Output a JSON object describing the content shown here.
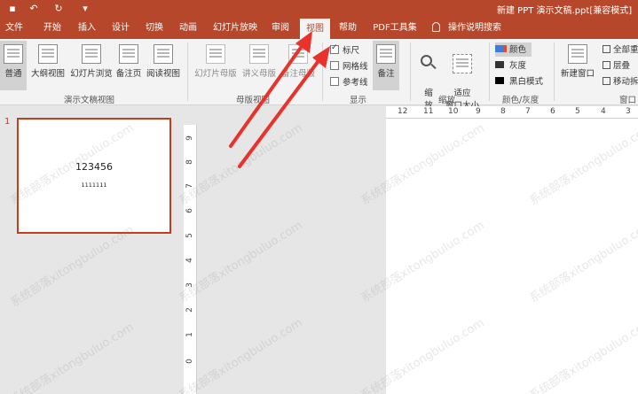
{
  "window": {
    "title": "新建 PPT 演示文稿.ppt[兼容模式]"
  },
  "quick_access": [
    {
      "icon": "save-icon"
    },
    {
      "icon": "undo-icon"
    },
    {
      "icon": "redo-icon"
    },
    {
      "icon": "customize-icon"
    }
  ],
  "tabs": [
    {
      "label": "文件"
    },
    {
      "label": "开始"
    },
    {
      "label": "插入"
    },
    {
      "label": "设计"
    },
    {
      "label": "切换"
    },
    {
      "label": "动画"
    },
    {
      "label": "幻灯片放映"
    },
    {
      "label": "审阅"
    },
    {
      "label": "视图",
      "active": true
    },
    {
      "label": "帮助"
    },
    {
      "label": "PDF工具集"
    }
  ],
  "tell_me": "操作说明搜索",
  "ribbon": {
    "presentation_views": {
      "label": "演示文稿视图",
      "buttons": [
        "普通",
        "大纲视图",
        "幻灯片浏览",
        "备注页",
        "阅读视图"
      ]
    },
    "master_views": {
      "label": "母版视图",
      "buttons": [
        "幻灯片母版",
        "讲义母版",
        "备注母版"
      ]
    },
    "show": {
      "label": "显示",
      "checkboxes": [
        {
          "label": "标尺",
          "checked": true
        },
        {
          "label": "网格线",
          "checked": false
        },
        {
          "label": "参考线",
          "checked": false
        }
      ],
      "notes_button": "备注"
    },
    "zoom": {
      "label": "缩放",
      "zoom_button": "缩\n放",
      "fit_button": "适应\n窗口大小"
    },
    "color_grayscale": {
      "label": "颜色/灰度",
      "items": [
        {
          "label": "颜色",
          "selected": true
        },
        {
          "label": "灰度"
        },
        {
          "label": "黑白模式"
        }
      ]
    },
    "window": {
      "label": "窗口",
      "new_window": "新建窗口",
      "items": [
        "全部重",
        "层叠",
        "移动拆"
      ]
    }
  },
  "slides": [
    {
      "number": "1",
      "title": "123456",
      "subtitle": "1111111"
    }
  ],
  "ruler": {
    "h_ticks": [
      "12",
      "11",
      "10",
      "9",
      "8",
      "7",
      "6",
      "5",
      "4",
      "3"
    ],
    "v_ticks": [
      "9",
      "8",
      "7",
      "6",
      "5",
      "4",
      "3",
      "2",
      "1",
      "0"
    ]
  },
  "watermark": "系统部落xitongbuluo.com",
  "colors": {
    "accent": "#b7472a",
    "annotation_arrow": "#e8322b"
  }
}
